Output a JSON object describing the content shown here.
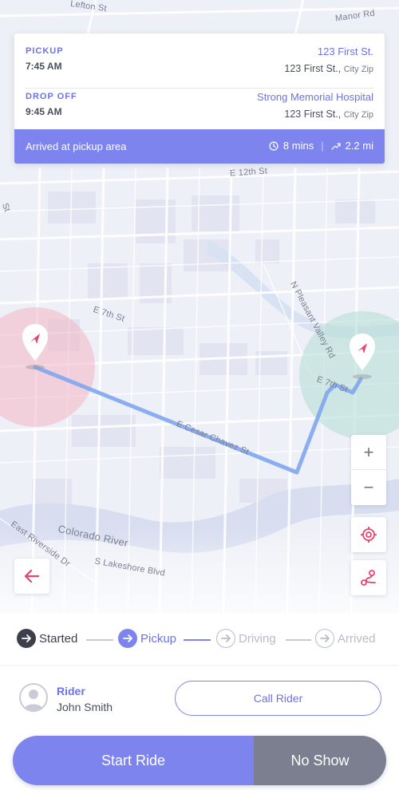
{
  "trip": {
    "pickup": {
      "label": "PICKUP",
      "time": "7:45 AM",
      "place": "123 First St.",
      "address": "123 First St.,",
      "city": "City Zip"
    },
    "dropoff": {
      "label": "DROP OFF",
      "time": "9:45 AM",
      "place": "Strong Memorial Hospital",
      "address": "123 First St.,",
      "city": "City Zip"
    },
    "status": {
      "text": "Arrived at pickup area",
      "duration": "8 mins",
      "distance": "2.2 mi",
      "duration_icon": "clock-icon",
      "distance_icon": "trend-icon"
    }
  },
  "map": {
    "labels": {
      "street_top": "Lefton St",
      "manor": "Manor Rd",
      "e12": "E 12th St",
      "st_left": "St",
      "e7_left": "E 7th St",
      "pleasant_valley": "N Pleasant Valley Rd",
      "e7_right": "E 7th St",
      "chavez": "E Cesar Chavez St",
      "colorado": "Colorado River",
      "east_riverside": "East Riverside Dr",
      "lakeshore": "S Lakeshore Blvd"
    },
    "controls": {
      "zoom_in": "+",
      "zoom_out": "−"
    },
    "colors": {
      "route": "#7fa6ef",
      "pickup_zone": "#f4b6c4",
      "dropoff_zone": "#b8e0d6",
      "pin": "#e8456a"
    }
  },
  "steps": [
    {
      "label": "Started",
      "state": "done"
    },
    {
      "label": "Pickup",
      "state": "active"
    },
    {
      "label": "Driving",
      "state": "pending"
    },
    {
      "label": "Arrived",
      "state": "pending"
    }
  ],
  "rider": {
    "role": "Rider",
    "name": "John Smith",
    "call_label": "Call Rider"
  },
  "actions": {
    "start_label": "Start Ride",
    "noshow_label": "No Show"
  },
  "colors": {
    "accent": "#7e84ee",
    "secondary": "#7b7f8f",
    "danger": "#e8456a"
  }
}
